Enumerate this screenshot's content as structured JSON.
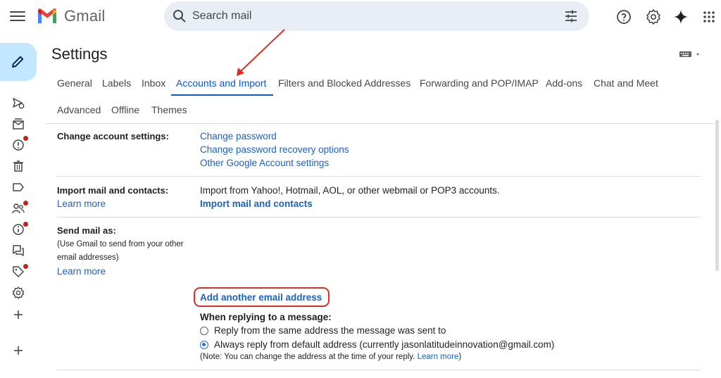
{
  "app": {
    "brand": "Gmail"
  },
  "search": {
    "placeholder": "Search mail"
  },
  "page": {
    "title": "Settings"
  },
  "tabs": [
    {
      "label": "General"
    },
    {
      "label": "Labels"
    },
    {
      "label": "Inbox"
    },
    {
      "label": "Accounts and Import",
      "active": true
    },
    {
      "label": "Filters and Blocked Addresses"
    },
    {
      "label": "Forwarding and POP/IMAP"
    },
    {
      "label": "Add-ons"
    },
    {
      "label": "Chat and Meet"
    },
    {
      "label": "Advanced"
    },
    {
      "label": "Offline"
    },
    {
      "label": "Themes"
    }
  ],
  "change_account": {
    "label": "Change account settings:",
    "links": [
      "Change password",
      "Change password recovery options",
      "Other Google Account settings"
    ]
  },
  "import_mail": {
    "label": "Import mail and contacts:",
    "learn_more": "Learn more",
    "description": "Import from Yahoo!, Hotmail, AOL, or other webmail or POP3 accounts.",
    "action": "Import mail and contacts"
  },
  "send_mail": {
    "label": "Send mail as:",
    "note_lines": [
      "(Use Gmail to send from your other",
      "email addresses)"
    ],
    "learn_more": "Learn more",
    "add_address": "Add another email address",
    "reply_heading": "When replying to a message:",
    "option_same": "Reply from the same address the message was sent to",
    "option_default": "Always reply from default address (currently jasonlatitudeinnovation@gmail.com)",
    "note": "(Note: You can change the address at the time of your reply.",
    "note_link": "Learn more",
    "note_end": ")"
  },
  "colors": {
    "accent": "#0b57d0",
    "link": "#1a62c4",
    "annotation": "#d93025",
    "compose_bg": "#c2e7ff"
  }
}
